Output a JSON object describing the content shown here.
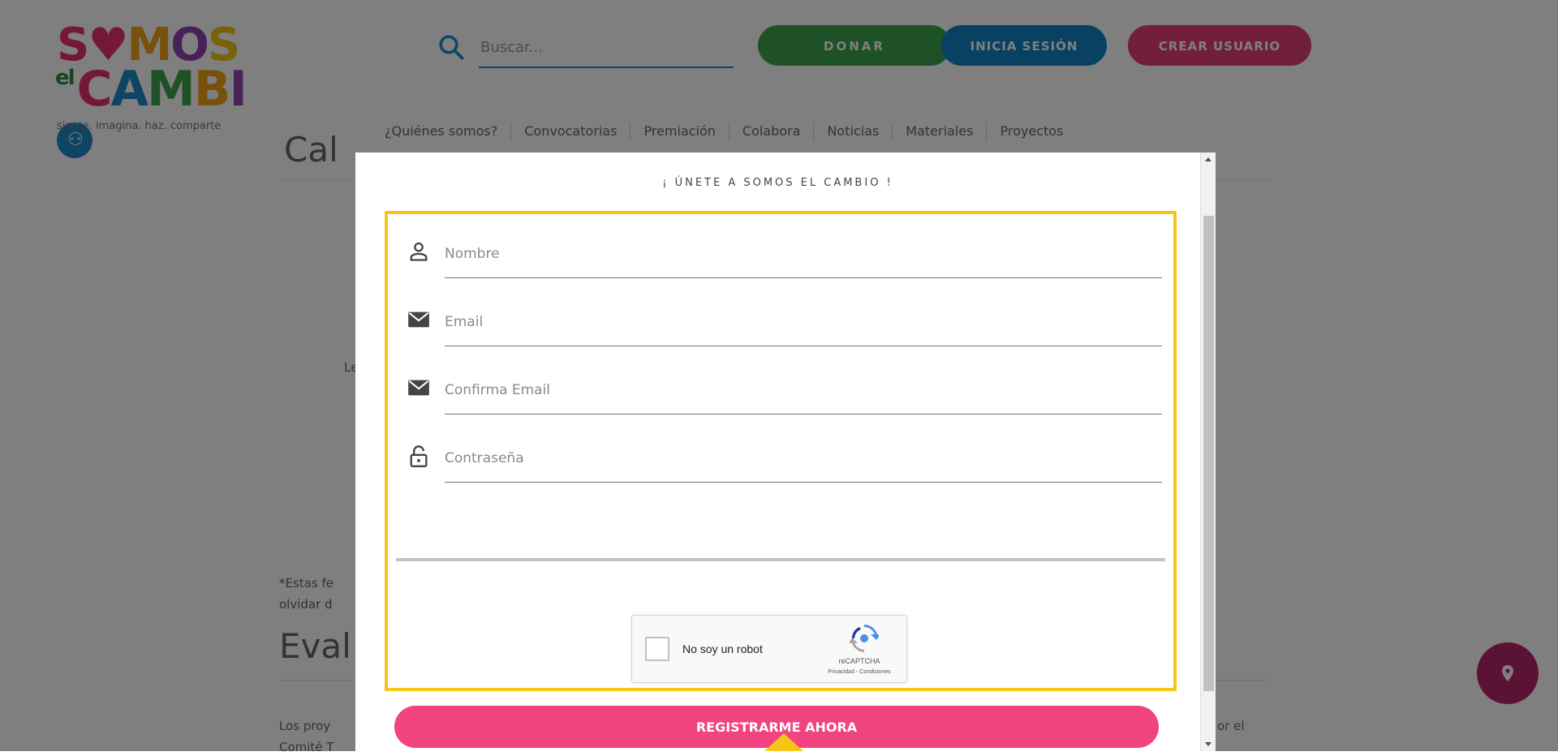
{
  "header": {
    "logo": {
      "word_somos": "SOMOS",
      "word_el": "el",
      "word_cambio": "CAMBIO",
      "tagline": "siente. imagina. haz. comparte"
    },
    "search": {
      "placeholder": "Buscar..."
    },
    "buttons": {
      "donate": "DONAR",
      "login": "INICIA SESIÓN",
      "create_user": "CREAR USUARIO"
    },
    "nav": [
      "¿Quiénes somos?",
      "Convocatorias",
      "Premiación",
      "Colabora",
      "Noticias",
      "Materiales",
      "Proyectos"
    ]
  },
  "background": {
    "heading_top": "Cal",
    "text_left_mid": "Le",
    "note_line1": "*Estas fe",
    "note_line2": "olvidar d",
    "heading_eval": "Eval",
    "para_line1": "Los proy",
    "para_line1_right": "or el",
    "para_line2": "Comité T"
  },
  "modal": {
    "title": "¡ ÚNETE A SOMOS EL CAMBIO !",
    "fields": [
      {
        "icon": "person-icon",
        "placeholder": "Nombre"
      },
      {
        "icon": "envelope-icon",
        "placeholder": "Email"
      },
      {
        "icon": "envelope-icon",
        "placeholder": "Confirma Email"
      },
      {
        "icon": "lock-icon",
        "placeholder": "Contraseña"
      }
    ],
    "captcha": {
      "label": "No soy un robot",
      "brand": "reCAPTCHA",
      "terms": "Privacidad - Condiciones"
    },
    "submit_label": "REGISTRARME AHORA"
  },
  "colors": {
    "donate": "#3fa34d",
    "login": "#1183c4",
    "create_user": "#e53e7a",
    "register": "#f0437f",
    "highlight": "#f5c518",
    "search_underline": "#1a8ec8"
  }
}
